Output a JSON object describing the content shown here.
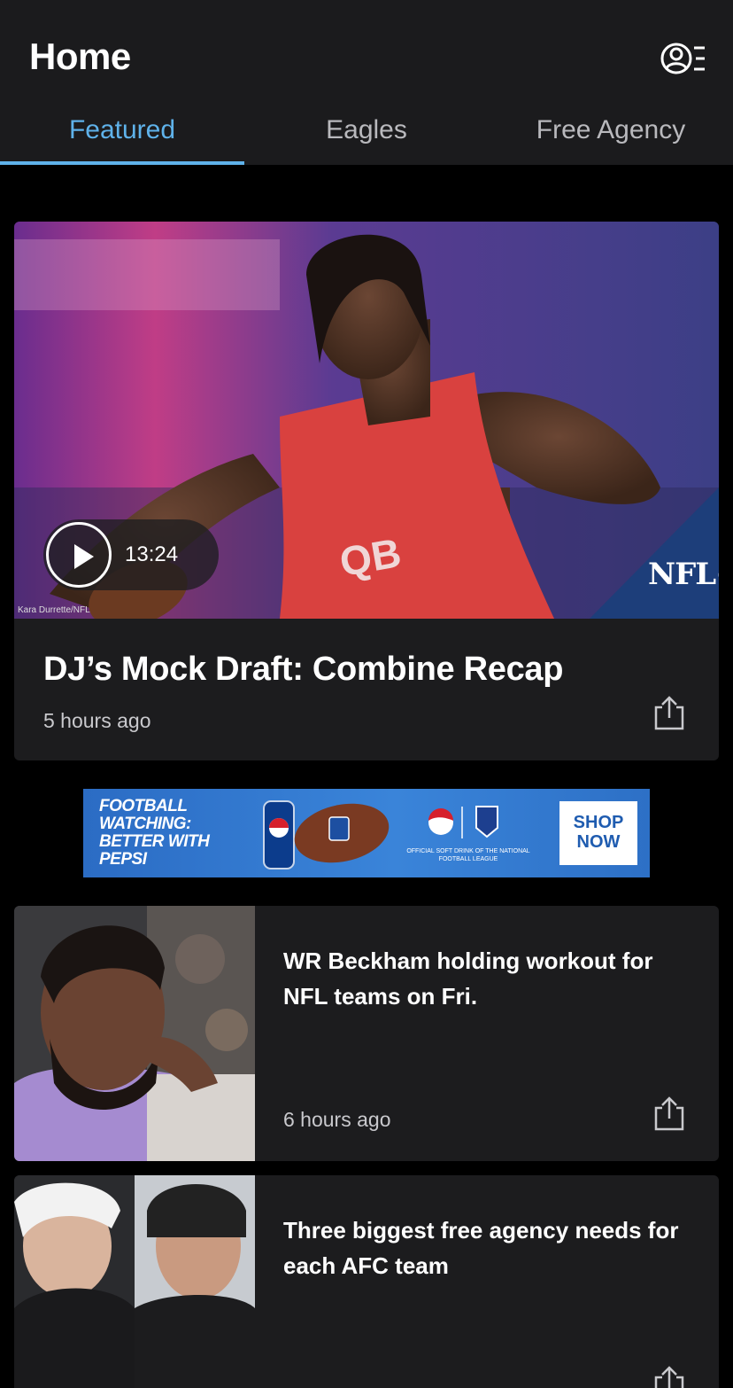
{
  "header": {
    "title": "Home",
    "profile_icon": "account-menu-icon"
  },
  "tabs": [
    {
      "label": "Featured",
      "active": true
    },
    {
      "label": "Eagles",
      "active": false
    },
    {
      "label": "Free Agency",
      "active": false
    }
  ],
  "hero": {
    "duration": "13:24",
    "photo_credit": "Kara Durrette/NFL",
    "badge": "NFL+",
    "title": "DJ’s Mock Draft: Combine Recap",
    "time": "5 hours ago"
  },
  "ad": {
    "headline": "Football Watching: Better With Pepsi",
    "fine_print": "OFFICIAL SOFT DRINK OF THE NATIONAL FOOTBALL LEAGUE",
    "cta": "SHOP NOW"
  },
  "stories": [
    {
      "title": "WR Beckham holding workout for NFL teams on Fri.",
      "time": "6 hours ago"
    },
    {
      "title": "Three biggest free agency needs for each AFC team",
      "time": ""
    }
  ],
  "colors": {
    "accent": "#5fb2ea",
    "header_bg": "#1b1b1d",
    "card_bg": "#1c1c1e",
    "page_bg": "#000000"
  }
}
